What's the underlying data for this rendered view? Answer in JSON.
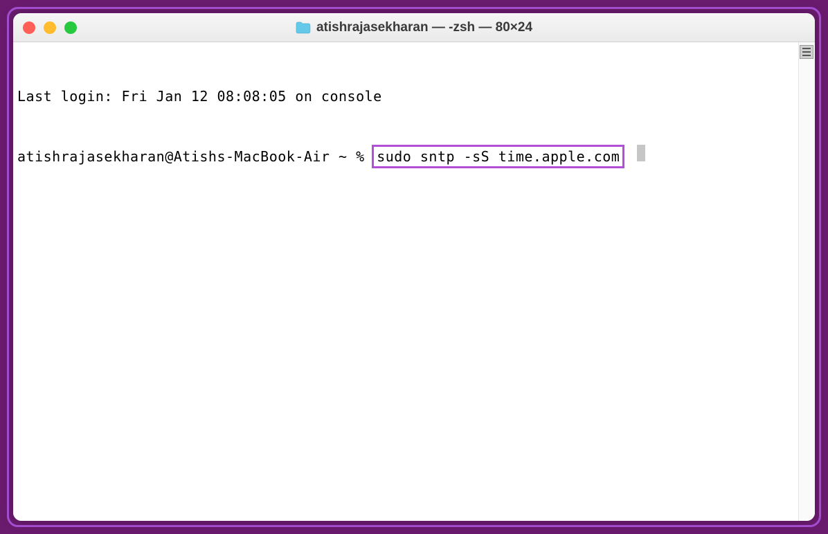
{
  "window": {
    "title": "atishrajasekharan — -zsh — 80×24"
  },
  "terminal": {
    "last_login": "Last login: Fri Jan 12 08:08:05 on console",
    "prompt": "atishrajasekharan@Atishs-MacBook-Air ~ % ",
    "command": "sudo sntp -sS time.apple.com"
  }
}
